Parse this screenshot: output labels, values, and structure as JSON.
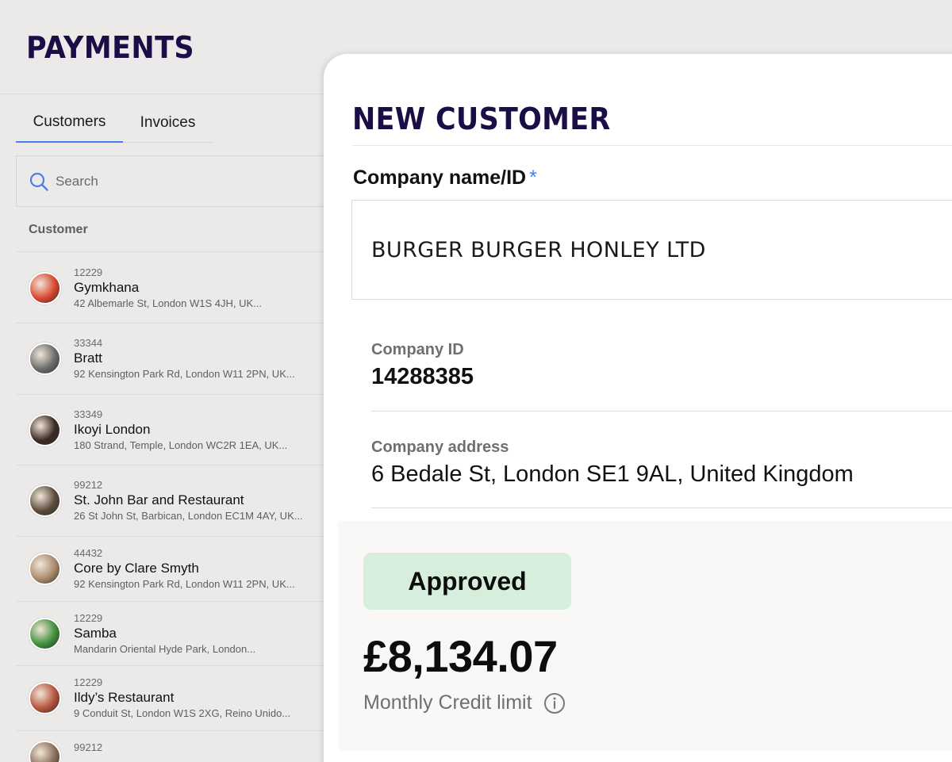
{
  "app": {
    "title": "PAYMENTS"
  },
  "tabs": [
    {
      "label": "Customers",
      "active": true
    },
    {
      "label": "Invoices",
      "active": false
    }
  ],
  "search": {
    "placeholder": "Search"
  },
  "list_header": {
    "column": "Customer"
  },
  "customers": [
    {
      "id": "12229",
      "name": "Gymkhana",
      "address": "42 Albemarle St, London W1S 4JH, UK...",
      "avatar_color": "#d8462f"
    },
    {
      "id": "33344",
      "name": "Bratt",
      "address": "92 Kensington Park Rd, London W11 2PN, UK...",
      "avatar_color": "#6b6b6b"
    },
    {
      "id": "33349",
      "name": "Ikoyi London",
      "address": "180 Strand, Temple, London WC2R 1EA, UK...",
      "avatar_color": "#3a2a24"
    },
    {
      "id": "99212",
      "name": "St. John Bar and Restaurant",
      "address": "26 St John St, Barbican, London EC1M 4AY, UK...",
      "avatar_color": "#5a4a3c"
    },
    {
      "id": "44432",
      "name": "Core by Clare Smyth",
      "address": "92 Kensington Park Rd, London W11 2PN, UK...",
      "avatar_color": "#a88a6a"
    },
    {
      "id": "12229",
      "name": "Samba",
      "address": "Mandarin Oriental Hyde Park, London...",
      "avatar_color": "#3f8f3a"
    },
    {
      "id": "12229",
      "name": "Ildy’s Restaurant",
      "address": "9 Conduit St, London W1S 2XG, Reino Unido...",
      "avatar_color": "#b5523a"
    },
    {
      "id": "99212",
      "name": "",
      "address": "",
      "avatar_color": "#8a6e58"
    }
  ],
  "panel": {
    "title": "NEW CUSTOMER",
    "company_name_label": "Company name/ID",
    "required_mark": "*",
    "company_name_value": "BURGER BURGER HONLEY LTD",
    "company_id_label": "Company ID",
    "company_id_value": "14288385",
    "company_address_label": "Company address",
    "company_address_value": "6 Bedale St, London SE1 9AL, United Kingdom",
    "status": "Approved",
    "credit_amount": "£8,134.07",
    "credit_label": "Monthly Credit limit"
  },
  "colors": {
    "brand": "#1b0d45",
    "accent": "#4a7df0",
    "approved_bg": "#d6eedb"
  },
  "icons": [
    "search-icon",
    "info-icon"
  ]
}
